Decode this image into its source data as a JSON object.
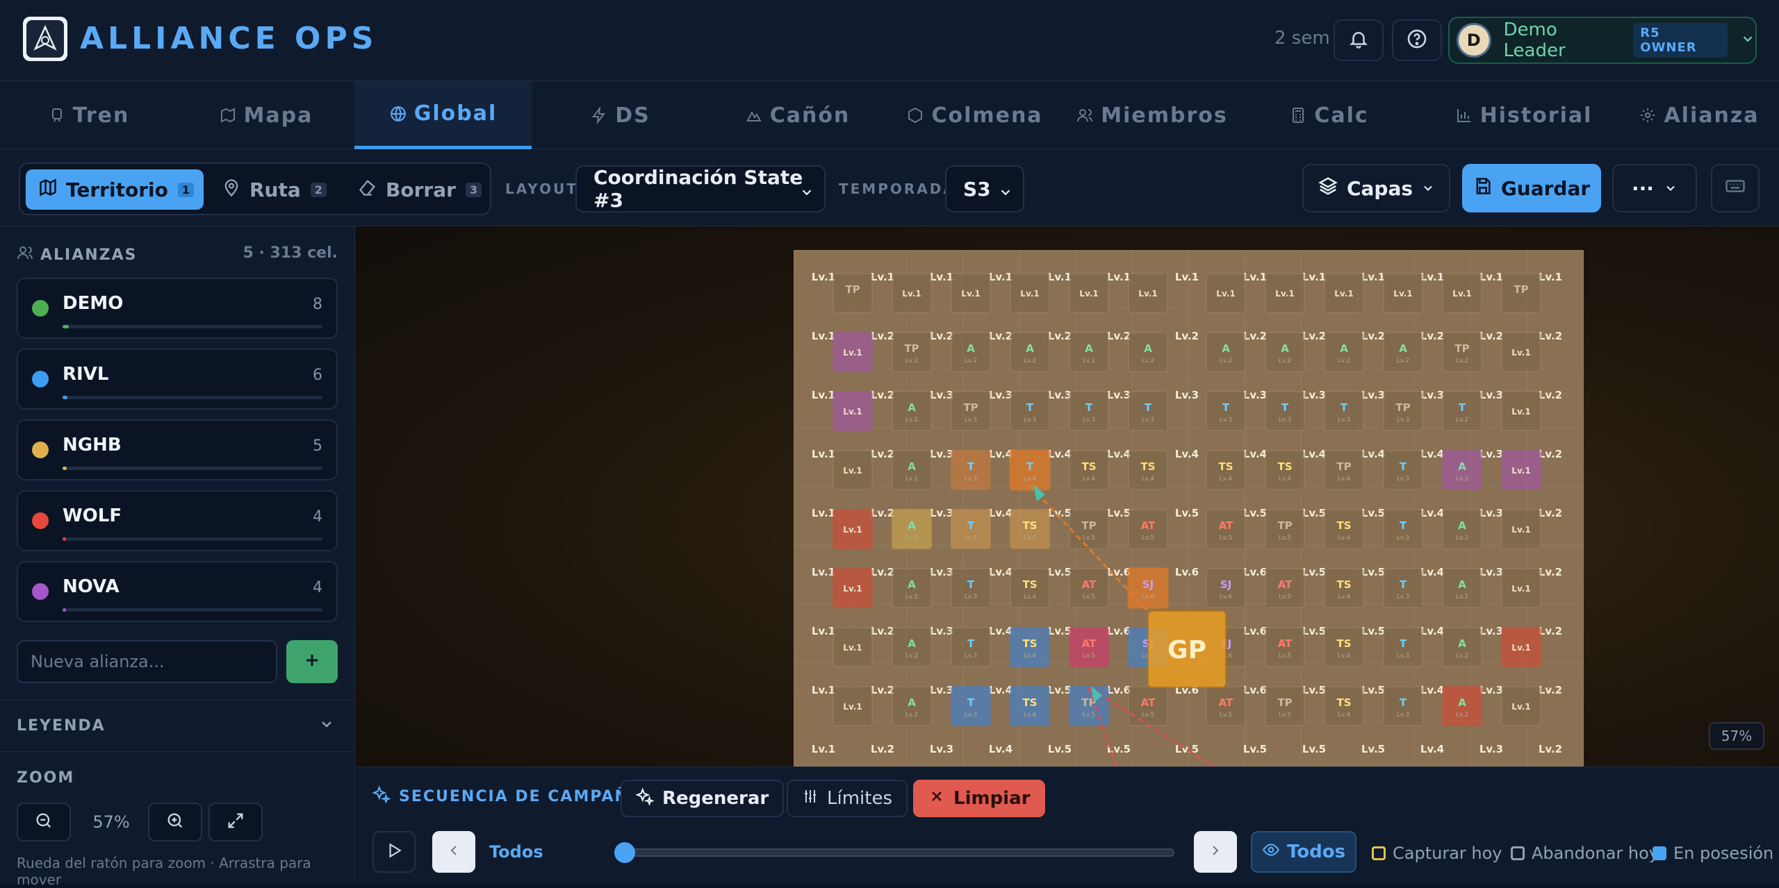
{
  "app": {
    "title": "ALLIANCE OPS",
    "season_label": "2 sem"
  },
  "user": {
    "initial": "D",
    "name": "Demo Leader",
    "role": "R5 OWNER"
  },
  "tabs": [
    {
      "label": "Tren",
      "icon": "train-icon"
    },
    {
      "label": "Mapa",
      "icon": "map-icon"
    },
    {
      "label": "Global",
      "icon": "globe-icon",
      "active": true
    },
    {
      "label": "DS",
      "icon": "bolt-icon"
    },
    {
      "label": "Cañón",
      "icon": "mountain-icon"
    },
    {
      "label": "Colmena",
      "icon": "hexagon-icon"
    },
    {
      "label": "Miembros",
      "icon": "users-icon"
    },
    {
      "label": "Calc",
      "icon": "calculator-icon"
    },
    {
      "label": "Historial",
      "icon": "bar-chart-icon"
    },
    {
      "label": "Alianza",
      "icon": "gear-icon"
    }
  ],
  "toolbar": {
    "modes": [
      {
        "label": "Territorio",
        "key": "1",
        "active": true
      },
      {
        "label": "Ruta",
        "key": "2"
      },
      {
        "label": "Borrar",
        "key": "3"
      }
    ],
    "layout_label": "LAYOUT",
    "layout_value": "Coordinación State #3",
    "season_label": "TEMPORADA",
    "season_value": "S3",
    "layers_label": "Capas",
    "save_label": "Guardar",
    "more_label": "···"
  },
  "sidebar": {
    "alliances_title": "ALIANZAS",
    "alliances_summary": "5 · 313 cel.",
    "alliances": [
      {
        "name": "DEMO",
        "count": "8",
        "color": "#4caf50",
        "fill": 0.025
      },
      {
        "name": "RIVL",
        "count": "6",
        "color": "#3d9df2",
        "fill": 0.019
      },
      {
        "name": "NGHB",
        "count": "5",
        "color": "#e0b04e",
        "fill": 0.016
      },
      {
        "name": "WOLF",
        "count": "4",
        "color": "#e7473c",
        "fill": 0.013
      },
      {
        "name": "NOVA",
        "count": "4",
        "color": "#a357c9",
        "fill": 0.013
      }
    ],
    "new_placeholder": "Nueva alianza...",
    "legend_title": "LEYENDA",
    "zoom_title": "ZOOM",
    "zoom_value": "57%",
    "zoom_hint": "Rueda del ratón para zoom · Arrastra para mover"
  },
  "map": {
    "zoom_badge": "57%",
    "center_label": "GP",
    "columns": 14,
    "rows": 9,
    "edge_labels": [
      [
        "Lv.1",
        "Lv.1",
        "Lv.1",
        "Lv.1",
        "Lv.1",
        "Lv.1",
        "Lv.1",
        "Lv.1",
        "Lv.1",
        "Lv.1",
        "Lv.1",
        "Lv.1",
        "Lv.1",
        "Lv.1"
      ],
      [
        "Lv.1",
        "Lv.2",
        "Lv.2",
        "Lv.2",
        "Lv.2",
        "Lv.2",
        "Lv.2",
        "Lv.2",
        "Lv.2",
        "Lv.2",
        "Lv.2",
        "Lv.2",
        "Lv.2",
        "Lv.1"
      ],
      [
        "Lv.1",
        "Lv.2",
        "Lv.3",
        "Lv.3",
        "Lv.3",
        "Lv.3",
        "Lv.3",
        "Lv.3",
        "Lv.3",
        "Lv.3",
        "Lv.3",
        "Lv.3",
        "Lv.2",
        "Lv.1"
      ],
      [
        "Lv.1",
        "Lv.2",
        "Lv.3",
        "Lv.4",
        "Lv.4",
        "Lv.4",
        "Lv.4",
        "Lv.4",
        "Lv.4",
        "Lv.4",
        "Lv.4",
        "Lv.3",
        "Lv.2",
        "Lv.1"
      ],
      [
        "Lv.1",
        "Lv.2",
        "Lv.3",
        "Lv.4",
        "Lv.5",
        "Lv.5",
        "Lv.5",
        "Lv.5",
        "Lv.5",
        "Lv.5",
        "Lv.4",
        "Lv.3",
        "Lv.2",
        "Lv.1"
      ],
      [
        "Lv.1",
        "Lv.2",
        "Lv.3",
        "Lv.4",
        "Lv.5",
        "Lv.6",
        "Lv.6",
        "Lv.6",
        "Lv.5",
        "Lv.5",
        "Lv.4",
        "Lv.3",
        "Lv.2",
        "Lv.1"
      ],
      [
        "Lv.1",
        "Lv.2",
        "Lv.3",
        "Lv.4",
        "Lv.5",
        "Lv.6",
        "",
        "Lv.6",
        "Lv.5",
        "Lv.5",
        "Lv.4",
        "Lv.3",
        "Lv.2",
        "Lv.1"
      ],
      [
        "Lv.1",
        "Lv.2",
        "Lv.3",
        "Lv.4",
        "Lv.5",
        "Lv.6",
        "Lv.6",
        "Lv.6",
        "Lv.5",
        "Lv.5",
        "Lv.4",
        "Lv.3",
        "Lv.2",
        "Lv.1"
      ],
      [
        "Lv.1",
        "Lv.2",
        "Lv.3",
        "Lv.4",
        "Lv.5",
        "Lv.5",
        "Lv.5",
        "Lv.5",
        "Lv.5",
        "Lv.5",
        "Lv.4",
        "Lv.3",
        "Lv.2",
        "Lv.1"
      ]
    ],
    "cells": [
      [
        [
          "TP",
          ""
        ],
        [
          "Lv.1",
          ""
        ],
        [
          "Lv.1",
          ""
        ],
        [
          "Lv.1",
          ""
        ],
        [
          "Lv.1",
          ""
        ],
        [
          "Lv.1",
          ""
        ],
        [
          "Lv.1",
          ""
        ],
        [
          "Lv.1",
          ""
        ],
        [
          "Lv.1",
          ""
        ],
        [
          "Lv.1",
          ""
        ],
        [
          "Lv.1",
          ""
        ],
        [
          "TP",
          ""
        ]
      ],
      [
        [
          "Lv.1",
          "Lv.1"
        ],
        [
          "TP",
          "Lv.2"
        ],
        [
          "A",
          "Lv.2"
        ],
        [
          "A",
          "Lv.2"
        ],
        [
          "A",
          "Lv.2"
        ],
        [
          "A",
          "Lv.2"
        ],
        [
          "A",
          "Lv.2"
        ],
        [
          "A",
          "Lv.2"
        ],
        [
          "A",
          "Lv.2"
        ],
        [
          "A",
          "Lv.2"
        ],
        [
          "TP",
          "Lv.2"
        ],
        [
          "Lv.1",
          ""
        ]
      ],
      [
        [
          "Lv.1",
          "Lv.1"
        ],
        [
          "A",
          "Lv.2"
        ],
        [
          "TP",
          "Lv.3"
        ],
        [
          "T",
          "Lv.3"
        ],
        [
          "T",
          "Lv.3"
        ],
        [
          "T",
          "Lv.3"
        ],
        [
          "T",
          "Lv.3"
        ],
        [
          "T",
          "Lv.3"
        ],
        [
          "T",
          "Lv.3"
        ],
        [
          "TP",
          "Lv.3"
        ],
        [
          "T",
          "Lv.2"
        ],
        [
          "Lv.1",
          ""
        ]
      ],
      [
        [
          "Lv.1",
          ""
        ],
        [
          "A",
          "Lv.2"
        ],
        [
          "T",
          "Lv.3"
        ],
        [
          "T",
          "Lv.4"
        ],
        [
          "TS",
          "Lv.4"
        ],
        [
          "TS",
          "Lv.4"
        ],
        [
          "TS",
          "Lv.4"
        ],
        [
          "TS",
          "Lv.4"
        ],
        [
          "TP",
          "Lv.4"
        ],
        [
          "T",
          "Lv.3"
        ],
        [
          "A",
          "Lv.2"
        ],
        [
          "Lv.1",
          ""
        ]
      ],
      [
        [
          "Lv.1",
          "Lv.1"
        ],
        [
          "A",
          "Lv.2"
        ],
        [
          "T",
          "Lv.3"
        ],
        [
          "TS",
          "Lv.4"
        ],
        [
          "TP",
          "Lv.5"
        ],
        [
          "AT",
          "Lv.5"
        ],
        [
          "AT",
          "Lv.5"
        ],
        [
          "TP",
          "Lv.5"
        ],
        [
          "TS",
          "Lv.4"
        ],
        [
          "T",
          "Lv.3"
        ],
        [
          "A",
          "Lv.2"
        ],
        [
          "Lv.1",
          ""
        ]
      ],
      [
        [
          "Lv.1",
          "Lv.1"
        ],
        [
          "A",
          "Lv.2"
        ],
        [
          "T",
          "Lv.3"
        ],
        [
          "TS",
          "Lv.4"
        ],
        [
          "AT",
          "Lv.5"
        ],
        [
          "SJ",
          "Lv.6"
        ],
        [
          "SJ",
          "Lv.6"
        ],
        [
          "AT",
          "Lv.5"
        ],
        [
          "TS",
          "Lv.4"
        ],
        [
          "T",
          "Lv.3"
        ],
        [
          "A",
          "Lv.2"
        ],
        [
          "Lv.1",
          ""
        ]
      ],
      [
        [
          "Lv.1",
          ""
        ],
        [
          "A",
          "Lv.2"
        ],
        [
          "T",
          "Lv.3"
        ],
        [
          "TS",
          "Lv.4"
        ],
        [
          "AT",
          "Lv.5"
        ],
        [
          "SJ",
          "Lv.6"
        ],
        [
          "SJ",
          "Lv.6"
        ],
        [
          "AT",
          "Lv.5"
        ],
        [
          "TS",
          "Lv.4"
        ],
        [
          "T",
          "Lv.3"
        ],
        [
          "A",
          "Lv.2"
        ],
        [
          "Lv.1",
          "Lv.1"
        ]
      ],
      [
        [
          "Lv.1",
          ""
        ],
        [
          "A",
          "Lv.2"
        ],
        [
          "T",
          "Lv.3"
        ],
        [
          "TS",
          "Lv.4"
        ],
        [
          "TP",
          "Lv.5"
        ],
        [
          "AT",
          "Lv.5"
        ],
        [
          "AT",
          "Lv.5"
        ],
        [
          "TP",
          "Lv.5"
        ],
        [
          "TS",
          "Lv.4"
        ],
        [
          "T",
          "Lv.3"
        ],
        [
          "A",
          "Lv.2"
        ],
        [
          "Lv.1",
          ""
        ]
      ]
    ]
  },
  "campaign": {
    "title": "SECUENCIA DE CAMPAÑA",
    "regen_label": "Regenerar",
    "limits_label": "Límites",
    "clear_label": "Limpiar",
    "all_label": "Todos",
    "filter_all": "Todos",
    "filters": [
      {
        "label": "Capturar hoy",
        "color": "#e0c34e",
        "filled": false
      },
      {
        "label": "Abandonar hoy",
        "color": "#93a1b6",
        "filled": false
      },
      {
        "label": "En posesión",
        "color": "#4aa3f2",
        "filled": true
      }
    ]
  }
}
